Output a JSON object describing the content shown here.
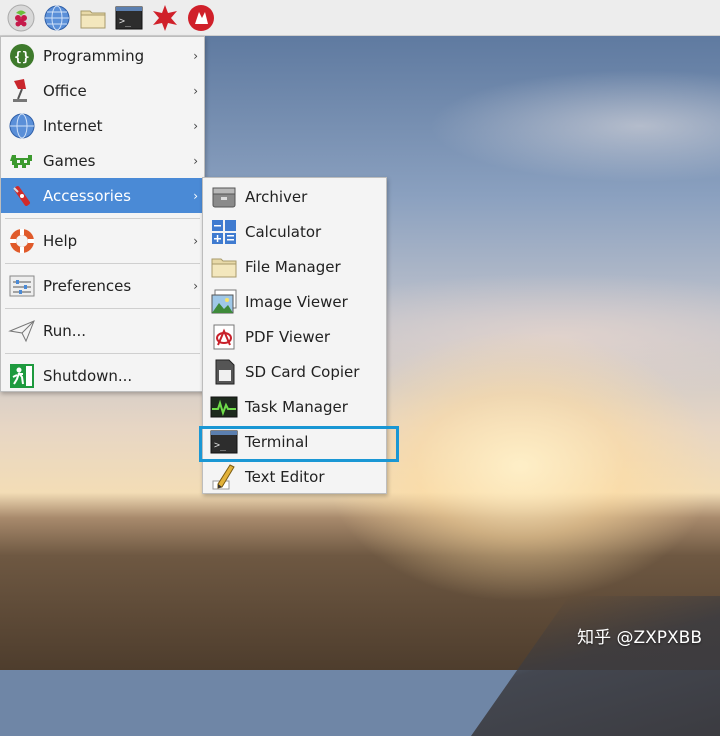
{
  "taskbar": {
    "icons": [
      "raspberry-menu-icon",
      "web-browser-icon",
      "file-manager-icon",
      "terminal-icon",
      "mathematica-icon",
      "wolfram-icon"
    ]
  },
  "main_menu": {
    "items": [
      {
        "label": "Programming",
        "icon": "programming-icon",
        "submenu": true
      },
      {
        "label": "Office",
        "icon": "office-icon",
        "submenu": true
      },
      {
        "label": "Internet",
        "icon": "internet-icon",
        "submenu": true
      },
      {
        "label": "Games",
        "icon": "games-icon",
        "submenu": true
      },
      {
        "label": "Accessories",
        "icon": "accessories-icon",
        "submenu": true,
        "active": true
      },
      {
        "label": "Help",
        "icon": "help-icon",
        "submenu": true
      },
      {
        "label": "Preferences",
        "icon": "preferences-icon",
        "submenu": true
      },
      {
        "label": "Run...",
        "icon": "run-icon",
        "submenu": false
      },
      {
        "label": "Shutdown...",
        "icon": "shutdown-icon",
        "submenu": false
      }
    ],
    "arrow": "›"
  },
  "accessories_menu": {
    "items": [
      {
        "label": "Archiver",
        "icon": "archiver-icon"
      },
      {
        "label": "Calculator",
        "icon": "calculator-icon"
      },
      {
        "label": "File Manager",
        "icon": "folder-icon"
      },
      {
        "label": "Image Viewer",
        "icon": "image-viewer-icon"
      },
      {
        "label": "PDF Viewer",
        "icon": "pdf-viewer-icon"
      },
      {
        "label": "SD Card Copier",
        "icon": "sd-card-icon"
      },
      {
        "label": "Task Manager",
        "icon": "task-manager-icon"
      },
      {
        "label": "Terminal",
        "icon": "terminal-icon",
        "highlighted": true
      },
      {
        "label": "Text Editor",
        "icon": "text-editor-icon"
      }
    ]
  },
  "watermark": "知乎 @ZXPXBB",
  "colors": {
    "accent": "#4a8ad6",
    "highlight_box": "#1a97d4"
  }
}
